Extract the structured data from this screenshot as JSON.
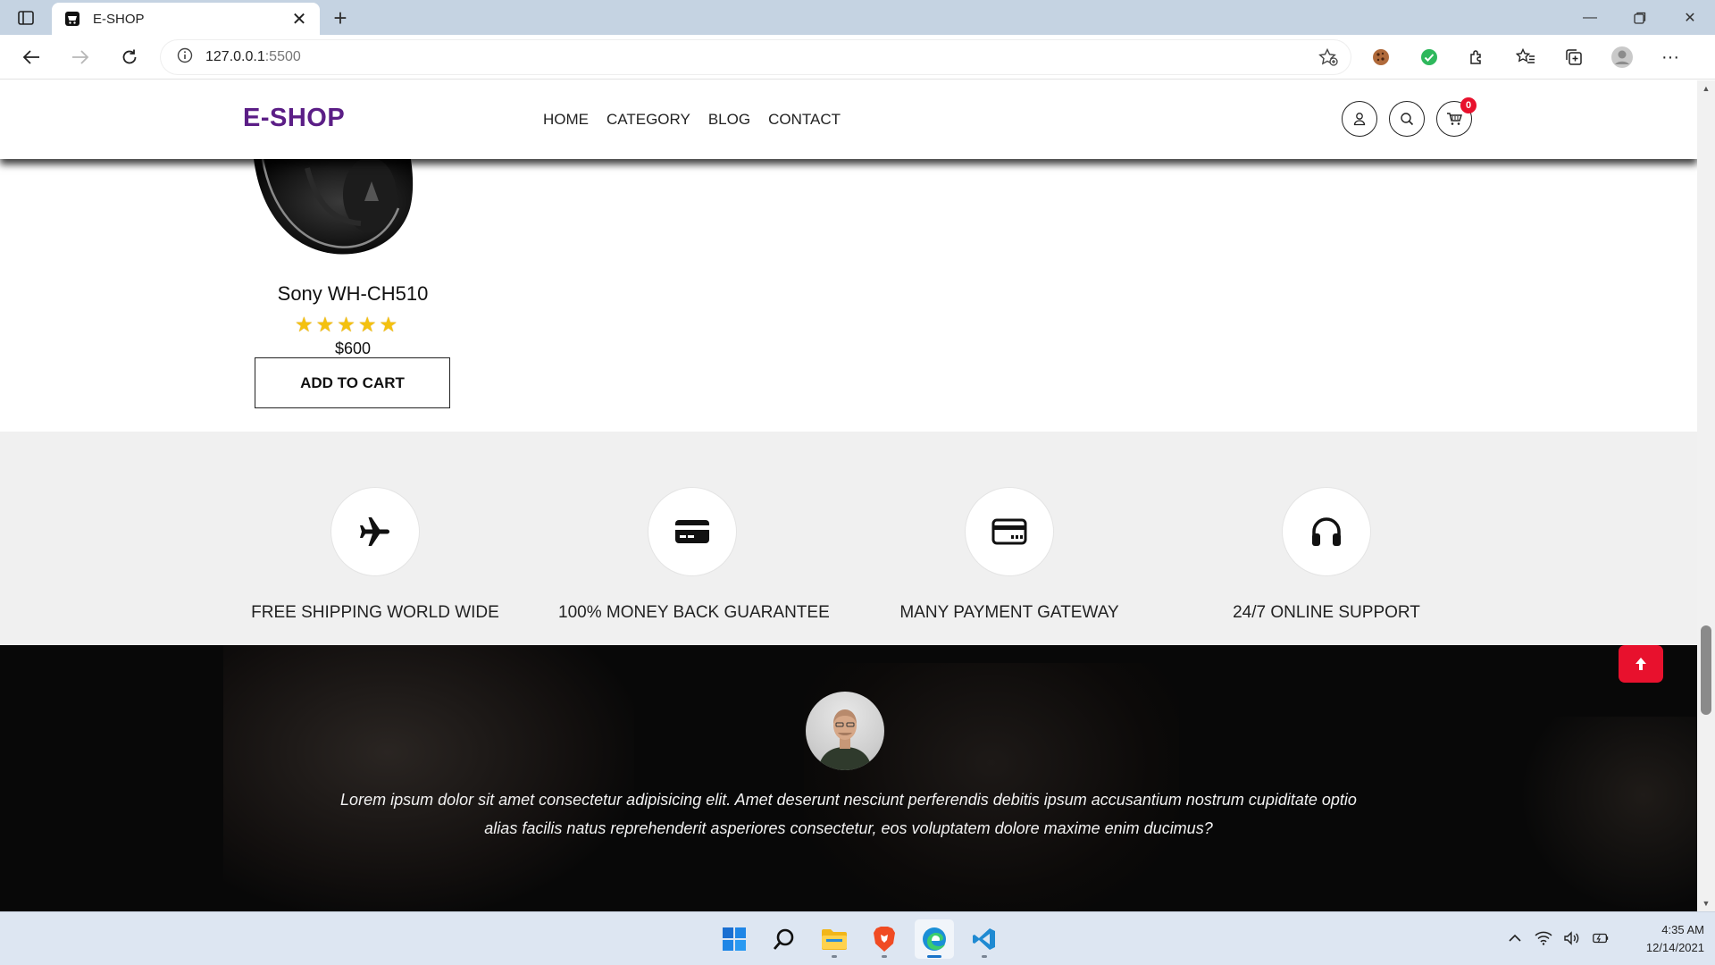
{
  "browser": {
    "tab_title": "E-SHOP",
    "url_host": "127.0.0.1",
    "url_port": ":5500"
  },
  "site": {
    "logo": "E-SHOP",
    "nav": [
      "HOME",
      "CATEGORY",
      "BLOG",
      "CONTACT"
    ],
    "cart_count": "0",
    "brand_color": "#5b1e86",
    "accent_color": "#e8112d"
  },
  "product": {
    "name": "Sony WH-CH510",
    "rating": 5,
    "rating_max": 5,
    "price": "$600",
    "button": "ADD TO CART"
  },
  "features": [
    {
      "icon": "airplane-icon",
      "label": "FREE SHIPPING WORLD WIDE"
    },
    {
      "icon": "credit-card-icon",
      "label": "100% MONEY BACK GUARANTEE"
    },
    {
      "icon": "payment-card-icon",
      "label": "MANY PAYMENT GATEWAY"
    },
    {
      "icon": "headphones-icon",
      "label": "24/7 ONLINE SUPPORT"
    }
  ],
  "testimonial": {
    "quote_line1": "Lorem ipsum dolor sit amet consectetur adipisicing elit. Amet deserunt nesciunt perferendis debitis ipsum accusantium nostrum cupiditate optio",
    "quote_line2": "alias facilis natus reprehenderit asperiores consectetur, eos voluptatem dolore maxime enim ducimus?"
  },
  "taskbar": {
    "time": "4:35 AM",
    "date": "12/14/2021"
  }
}
